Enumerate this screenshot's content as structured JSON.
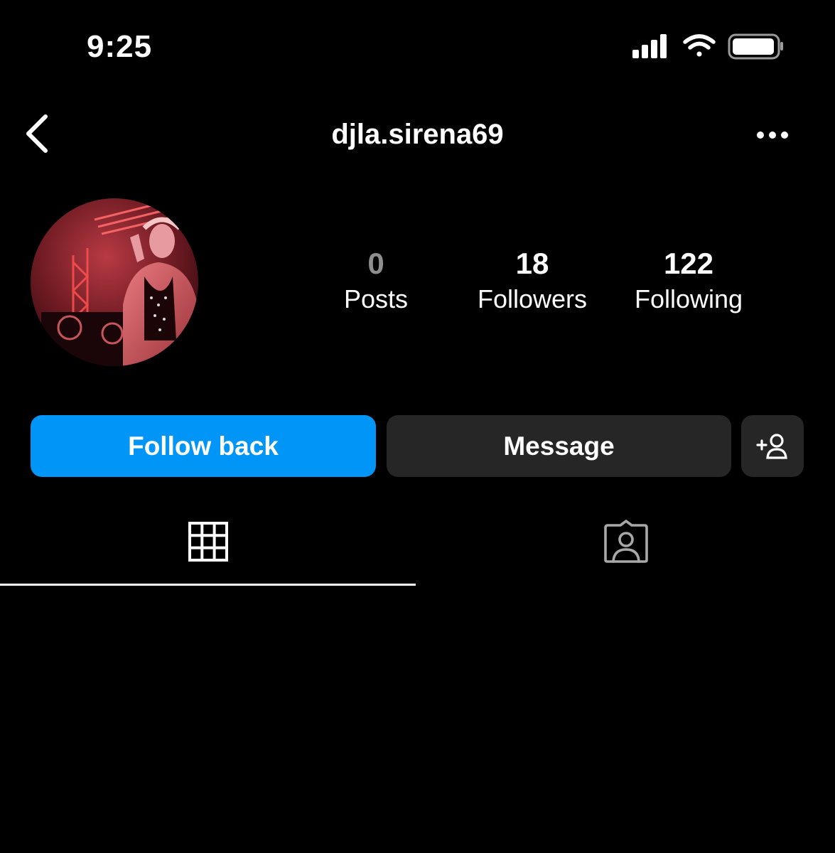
{
  "status_bar": {
    "time": "9:25",
    "icons": [
      "cellular-signal-icon",
      "wifi-icon",
      "battery-icon"
    ]
  },
  "header": {
    "back_icon": "chevron-left-icon",
    "username": "djla.sirena69",
    "more_icon": "more-horizontal-icon"
  },
  "profile": {
    "avatar": "profile-photo",
    "stats": [
      {
        "value": "0",
        "label": "Posts"
      },
      {
        "value": "18",
        "label": "Followers"
      },
      {
        "value": "122",
        "label": "Following"
      }
    ]
  },
  "actions": {
    "follow_label": "Follow back",
    "message_label": "Message",
    "add_user_icon": "person-add-icon"
  },
  "tabs": [
    {
      "icon": "grid-icon",
      "active": true
    },
    {
      "icon": "tagged-person-icon",
      "active": false
    }
  ],
  "colors": {
    "background": "#000000",
    "primary": "#0095f6",
    "secondary_button": "#262626",
    "muted_text": "#8e8e8e",
    "text": "#ffffff"
  }
}
